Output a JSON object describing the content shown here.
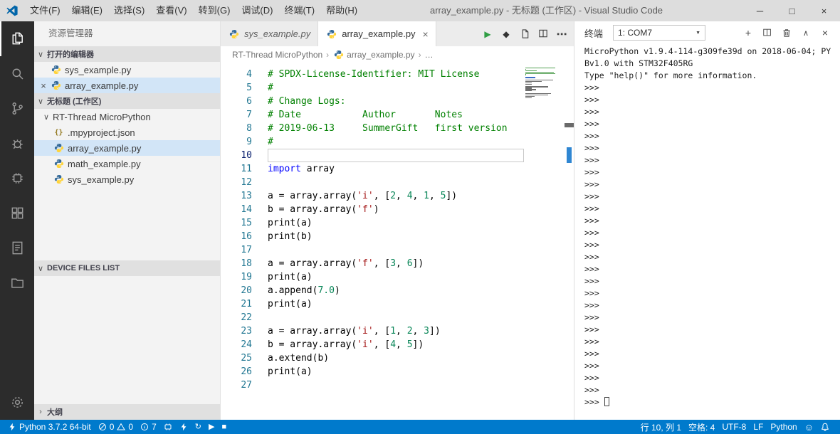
{
  "colors": {
    "accent": "#007acc",
    "titlebar_bg": "#dddddd",
    "activitybar_bg": "#2c2c2c",
    "sidebar_bg": "#f3f3f3",
    "selection_bg": "#d2e5f7",
    "comment": "#008000",
    "keyword": "#0000ff",
    "string": "#a31515",
    "number": "#098658"
  },
  "window": {
    "menus": [
      "文件(F)",
      "编辑(E)",
      "选择(S)",
      "查看(V)",
      "转到(G)",
      "调试(D)",
      "终端(T)",
      "帮助(H)"
    ],
    "title": "array_example.py - 无标题 (工作区) - Visual Studio Code",
    "controls": {
      "minimize": "─",
      "maximize": "□",
      "close": "×"
    }
  },
  "activity_bar": {
    "items": [
      "explorer-icon",
      "search-icon",
      "source-control-icon",
      "debug-icon",
      "board-icon",
      "extensions-icon",
      "notes-icon",
      "project-icon",
      "settings-gear-icon"
    ]
  },
  "sidebar": {
    "title": "资源管理器",
    "open_editors": {
      "label": "打开的编辑器",
      "chevron": "∨",
      "items": [
        {
          "label": "sys_example.py"
        },
        {
          "label": "array_example.py",
          "close": "×",
          "selected": true
        }
      ]
    },
    "workspace": {
      "label": "无标题 (工作区)",
      "chevron": "∨",
      "folder": {
        "label": "RT-Thread MicroPython",
        "chevron": "∨"
      },
      "files": [
        {
          "label": ".mpyproject.json",
          "icon": "json",
          "glyph": "{}"
        },
        {
          "label": "array_example.py",
          "icon": "python",
          "selected": true
        },
        {
          "label": "math_example.py",
          "icon": "python"
        },
        {
          "label": "sys_example.py",
          "icon": "python"
        }
      ]
    },
    "device_files": {
      "label": "DEVICE FILES LIST",
      "chevron": "∨"
    },
    "outline": {
      "label": "大纲",
      "chevron": "›"
    }
  },
  "editor": {
    "tabs": [
      {
        "label": "sys_example.py",
        "preview": true
      },
      {
        "label": "array_example.py",
        "active": true,
        "close": "×"
      }
    ],
    "actions": {
      "run": "▶",
      "download": "◆",
      "more": "⋯"
    },
    "breadcrumb": {
      "items": [
        "RT-Thread MicroPython",
        "array_example.py",
        "…"
      ],
      "separator": "›"
    },
    "cursor_line": 10,
    "lines": [
      {
        "n": 4,
        "t": [
          [
            "c",
            "# SPDX-License-Identifier: MIT License"
          ]
        ]
      },
      {
        "n": 5,
        "t": [
          [
            "c",
            "#"
          ]
        ]
      },
      {
        "n": 6,
        "t": [
          [
            "c",
            "# Change Logs:"
          ]
        ]
      },
      {
        "n": 7,
        "t": [
          [
            "c",
            "# Date           Author       Notes"
          ]
        ]
      },
      {
        "n": 8,
        "t": [
          [
            "c",
            "# 2019-06-13     SummerGift   first version"
          ]
        ]
      },
      {
        "n": 9,
        "t": [
          [
            "c",
            "#"
          ]
        ]
      },
      {
        "n": 10,
        "cursor": true,
        "t": []
      },
      {
        "n": 11,
        "t": [
          [
            "k",
            "import"
          ],
          [
            "p",
            " array"
          ]
        ]
      },
      {
        "n": 12,
        "t": []
      },
      {
        "n": 13,
        "t": [
          [
            "p",
            "a = array.array("
          ],
          [
            "s",
            "'i'"
          ],
          [
            "p",
            ", ["
          ],
          [
            "n",
            "2"
          ],
          [
            "p",
            ", "
          ],
          [
            "n",
            "4"
          ],
          [
            "p",
            ", "
          ],
          [
            "n",
            "1"
          ],
          [
            "p",
            ", "
          ],
          [
            "n",
            "5"
          ],
          [
            "p",
            "])"
          ]
        ]
      },
      {
        "n": 14,
        "t": [
          [
            "p",
            "b = array.array("
          ],
          [
            "s",
            "'f'"
          ],
          [
            "p",
            ")"
          ]
        ]
      },
      {
        "n": 15,
        "t": [
          [
            "p",
            "print(a)"
          ]
        ]
      },
      {
        "n": 16,
        "t": [
          [
            "p",
            "print(b)"
          ]
        ]
      },
      {
        "n": 17,
        "t": []
      },
      {
        "n": 18,
        "t": [
          [
            "p",
            "a = array.array("
          ],
          [
            "s",
            "'f'"
          ],
          [
            "p",
            ", ["
          ],
          [
            "n",
            "3"
          ],
          [
            "p",
            ", "
          ],
          [
            "n",
            "6"
          ],
          [
            "p",
            "])"
          ]
        ]
      },
      {
        "n": 19,
        "t": [
          [
            "p",
            "print(a)"
          ]
        ]
      },
      {
        "n": 20,
        "t": [
          [
            "p",
            "a.append("
          ],
          [
            "n",
            "7.0"
          ],
          [
            "p",
            ")"
          ]
        ]
      },
      {
        "n": 21,
        "t": [
          [
            "p",
            "print(a)"
          ]
        ]
      },
      {
        "n": 22,
        "t": []
      },
      {
        "n": 23,
        "t": [
          [
            "p",
            "a = array.array("
          ],
          [
            "s",
            "'i'"
          ],
          [
            "p",
            ", ["
          ],
          [
            "n",
            "1"
          ],
          [
            "p",
            ", "
          ],
          [
            "n",
            "2"
          ],
          [
            "p",
            ", "
          ],
          [
            "n",
            "3"
          ],
          [
            "p",
            "])"
          ]
        ]
      },
      {
        "n": 24,
        "t": [
          [
            "p",
            "b = array.array("
          ],
          [
            "s",
            "'i'"
          ],
          [
            "p",
            ", ["
          ],
          [
            "n",
            "4"
          ],
          [
            "p",
            ", "
          ],
          [
            "n",
            "5"
          ],
          [
            "p",
            "])"
          ]
        ]
      },
      {
        "n": 25,
        "t": [
          [
            "p",
            "a.extend(b)"
          ]
        ]
      },
      {
        "n": 26,
        "t": [
          [
            "p",
            "print(a)"
          ]
        ]
      },
      {
        "n": 27,
        "t": []
      }
    ]
  },
  "terminal": {
    "title": "终端",
    "select": {
      "value": "1: COM7",
      "caret": "▼"
    },
    "actions": {
      "new": "+",
      "maximize": "∧",
      "close": "×"
    },
    "intro_lines": [
      "MicroPython v1.9.4-114-g309fe39d on 2018-06-04; PY",
      "Bv1.0 with STM32F405RG",
      "Type \"help()\" for more information."
    ],
    "prompt": ">>>",
    "prompt_rows": 26,
    "cursor_row_prompt": ">>>"
  },
  "status_bar": {
    "interpreter": "Python 3.7.2 64-bit",
    "errors": "0",
    "warnings": "0",
    "info": "7",
    "glyphs": {
      "sync": "↻",
      "run": "▶",
      "stop": "■"
    },
    "line_col": "行 10, 列 1",
    "spaces": "空格: 4",
    "encoding": "UTF-8",
    "eol": "LF",
    "language": "Python",
    "feedback": "☺"
  }
}
